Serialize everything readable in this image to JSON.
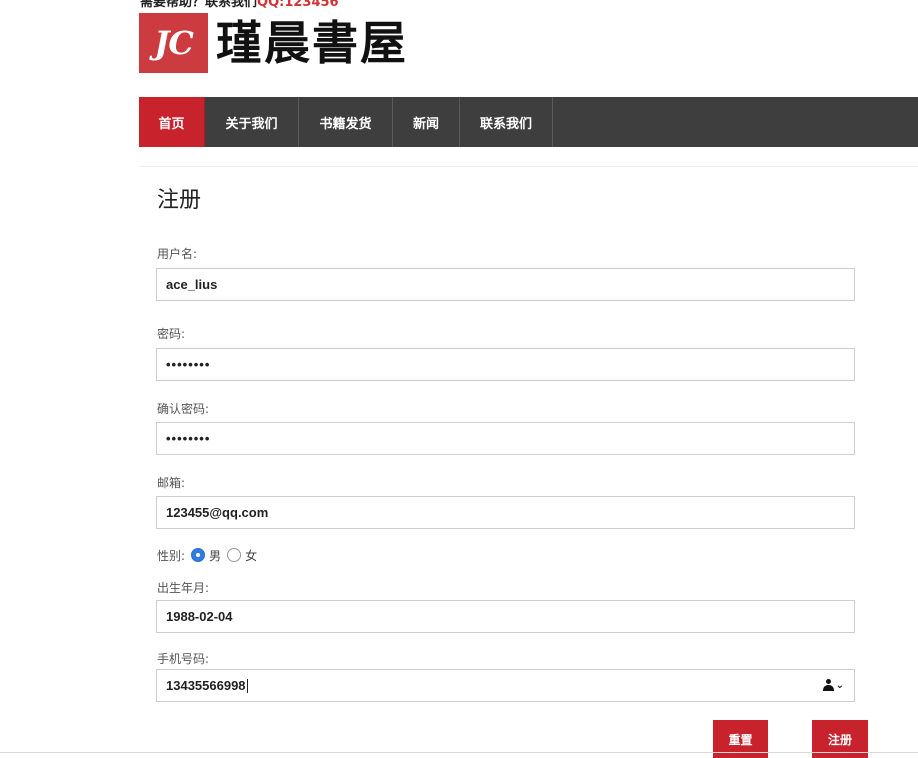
{
  "header": {
    "help_text": "需要帮助？联系我们",
    "qq_text": "QQ:123456",
    "logo_mark": "JC",
    "logo_text": "瑾晨書屋",
    "brand_color": "#cc3b3f"
  },
  "nav": {
    "items": [
      {
        "label": "首页",
        "active": true
      },
      {
        "label": "关于我们",
        "active": false
      },
      {
        "label": "书籍发货",
        "active": false
      },
      {
        "label": "新闻",
        "active": false
      },
      {
        "label": "联系我们",
        "active": false
      }
    ],
    "active_color": "#c8222d",
    "bar_color": "#3e3e3e"
  },
  "form": {
    "title": "注册",
    "username": {
      "label": "用户名:",
      "value": "ace_lius"
    },
    "password": {
      "label": "密码:",
      "value": "••••••••"
    },
    "confirm_password": {
      "label": "确认密码:",
      "value": "••••••••"
    },
    "email": {
      "label": "邮箱:",
      "value": "123455@qq.com"
    },
    "gender": {
      "label": "性别:",
      "options": [
        "男",
        "女"
      ],
      "selected": "男"
    },
    "birthday": {
      "label": "出生年月:",
      "value": "1988-02-04"
    },
    "phone": {
      "label": "手机号码:",
      "value": "13435566998",
      "icon": "contact-card-icon"
    },
    "reset_label": "重置",
    "submit_label": "注册"
  }
}
